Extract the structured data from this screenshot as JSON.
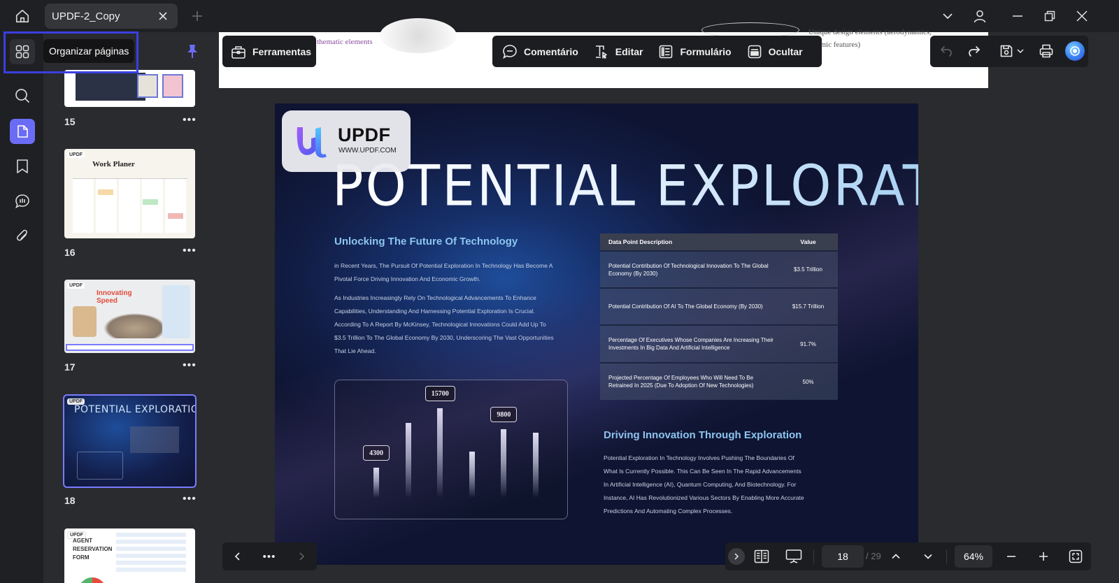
{
  "titlebar": {
    "tab_title": "UPDF-2_Copy"
  },
  "rail": {
    "tooltip": "Organizar páginas"
  },
  "thumbnails": [
    {
      "page": "15",
      "caption": ""
    },
    {
      "page": "16",
      "caption": "Work Planer"
    },
    {
      "page": "17",
      "caption": "Innovating Speed"
    },
    {
      "page": "18",
      "caption": "POTENTIAL EXPLORATION"
    },
    {
      "page": "",
      "caption": "AGENT RESERVATION FORM"
    }
  ],
  "more_glyph": "•••",
  "prev_page": {
    "fragment_left": "thematic elements",
    "fragment_right_1": "Unique design elements (aerodynamics,",
    "fragment_right_2": "onomic features)"
  },
  "toolbar": {
    "tools": "Ferramentas",
    "comment": "Comentário",
    "edit": "Editar",
    "form": "Formulário",
    "hide": "Ocultar"
  },
  "page": {
    "logo_text": "UPDF",
    "logo_url": "WWW.UPDF.COM",
    "title": "POTENTIAL EXPLORATION",
    "subheading_left": "Unlocking The Future Of Technology",
    "para_left_1": "in Recent Years, The Pursuit Of Potential Exploration In Technology Has Become A Pivotal Force Driving Innovation And Economic Growth.",
    "para_left_2": "As Industries Increasingly Rely On Technological Advancements To Enhance Capabilities, Understanding And Harnessing Potential Exploration Is Crucial. According To A Report By McKinsey, Technological Innovations Could Add Up To $3.5 Trillion To The Global Economy By 2030, Underscoring The Vast Opportunities That Lie Ahead.",
    "subheading_right": "Driving Innovation Through Exploration",
    "para_right": "Potential Exploration In Technology Involves Pushing The Boundaries Of What Is Currently Possible. This Can Be Seen In The Rapid Advancements In Artificial Intelligence (AI), Quantum Computing, And Biotechnology. For Instance, AI Has Revolutionized Various Sectors By Enabling More Accurate Predictions And Automating Complex Processes.",
    "table": {
      "header": [
        "Data Point Description",
        "Value"
      ],
      "rows": [
        [
          "Potential Contribution Of Technological Innovation To The Global Economy (By 2030)",
          "$3.5 Trillion"
        ],
        [
          "Potential Contribution Of AI To The Global Economy (By 2030)",
          "$15.7 Trillion"
        ],
        [
          "Percentage Of Executives Whose Companies Are Increasing Their Investments In Big Data And Artificial Intelligence",
          "91.7%"
        ],
        [
          "Projected Percentage Of Employees Who Will Need To Be Retrained In 2025 (Due To Adoption Of New Technologies)",
          "50%"
        ]
      ]
    }
  },
  "chart_data": {
    "type": "bar",
    "values": [
      4300,
      null,
      15700,
      null,
      9800,
      null
    ],
    "relative_heights": [
      0.27,
      0.68,
      0.81,
      0.42,
      0.62,
      0.59
    ],
    "data_labels": [
      "4300",
      "15700",
      "9800"
    ],
    "title": "",
    "xlabel": "",
    "ylabel": ""
  },
  "bottombar": {
    "page_current": "18",
    "page_total": "/ 29",
    "zoom": "64%"
  }
}
